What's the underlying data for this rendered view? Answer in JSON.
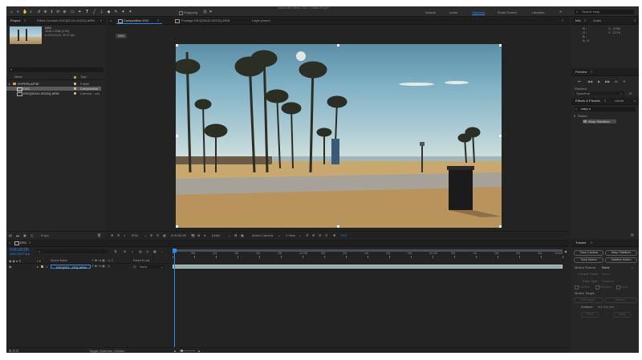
{
  "app_title": "Adobe After Effects 2020 - Untitled Project *",
  "workspaces": [
    "Default",
    "Learn",
    "Standard",
    "Small Screen",
    "Libraries"
  ],
  "workspace_active": "Standard",
  "search_help_placeholder": "Search Help",
  "toolbar": {
    "snapping_label": "Snapping"
  },
  "project": {
    "tab_label": "Project",
    "effect_controls_tab": "Effect Controls DSC[00141-00231].ARW",
    "selected_name": "DSC",
    "selected_info": [
      "4048 x 2268 (1.00)",
      "Δ 0;00;01;01, 29.97 fps"
    ],
    "search_placeholder": "",
    "columns": {
      "name": "Name",
      "type": "Type"
    },
    "items": [
      {
        "name": "HYPERLAPSE",
        "type": "Folder"
      },
      {
        "name": "DSC",
        "type": "Composition"
      },
      {
        "name": "DSC[00141-00231].ARW",
        "type": "Camera ...ers"
      }
    ],
    "bpc": "8 bpc"
  },
  "viewer": {
    "comp_tab": "Composition DSC",
    "footage_tab": "Footage DSC[00141-00231].ARW",
    "layer_tab": "Layer (none)",
    "comp_chip": "DSC",
    "zoom": "50%",
    "timecode": "0;00;00;00",
    "resolution": "(Half)",
    "camera": "Active Camera",
    "views": "1 View",
    "exposure": "+0.0"
  },
  "info": {
    "tab_info": "Info",
    "tab_audio": "Audio",
    "channels": [
      "R :",
      "G :",
      "B :",
      "A : 0"
    ],
    "coords": [
      "X : 4780",
      "Y : 2176"
    ]
  },
  "preview": {
    "title": "Preview",
    "shortcut_label": "Shortcut",
    "shortcut_value": "Spacebar"
  },
  "effects": {
    "tab_effects": "Effects & Presets",
    "tab_library": "Librari",
    "search_value": "warp s",
    "category": "Distort",
    "result": "Warp Stabilizer"
  },
  "tracker": {
    "title": "Tracker",
    "buttons": [
      "Track Camera",
      "Warp Stabilizer",
      "Track Motion",
      "Stabilize Motion"
    ],
    "motion_source_label": "Motion Source:",
    "motion_source_value": "None",
    "current_track_label": "Current Track:",
    "current_track_value": "None",
    "track_type_label": "Track Type:",
    "track_type_value": "Stabilize",
    "checkboxes": [
      "Position",
      "Rotation",
      "Scale"
    ],
    "motion_target": "Motion Target:",
    "edit_target": "Edit Target...",
    "options": "Options...",
    "analyze": "Analyze:",
    "reset": "Reset",
    "apply": "Apply"
  },
  "timeline": {
    "tab": "DSC",
    "timecode": "0;00;00;00",
    "fps": "00000 (29.97 fps)",
    "search_placeholder": "",
    "columns": {
      "source_name": "Source Name",
      "parent": "Parent & Link"
    },
    "layer_index": "1",
    "layer_name": "DSC[001...231].ARW",
    "parent_value": "None",
    "toggle_label": "Toggle Switches / Modes",
    "ruler": [
      "0f",
      "05f",
      "10f",
      "15f",
      "20f",
      "25f",
      "01:00f",
      "05f",
      "10f",
      "15f",
      "20f",
      "25f",
      "02:00f",
      "05f",
      "10f",
      "15f",
      "20f",
      "25f",
      "03:00f"
    ]
  }
}
